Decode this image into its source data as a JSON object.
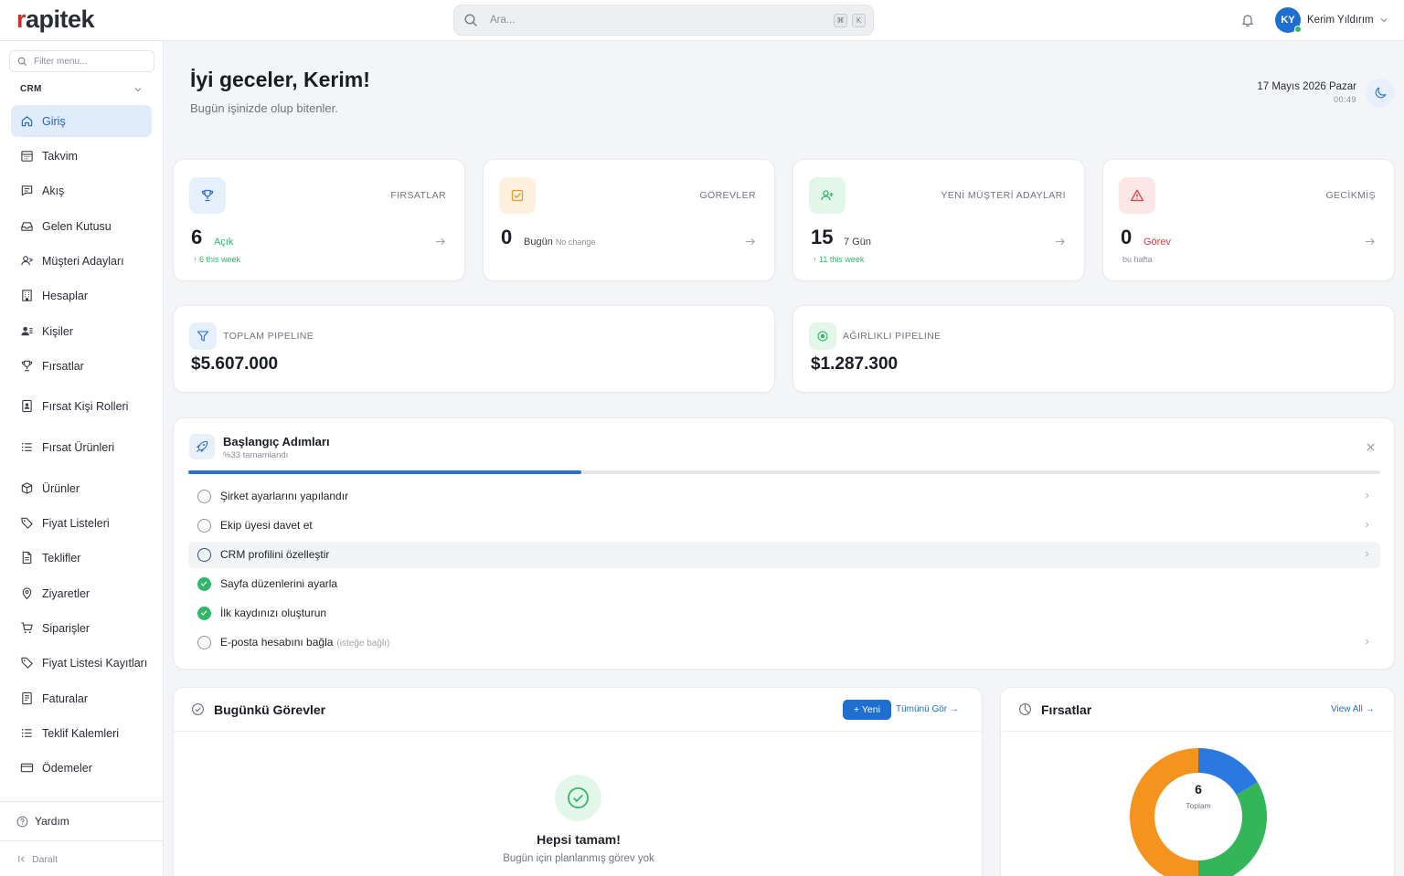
{
  "app": {
    "logo_accent": "r",
    "logo_rest": "apitek",
    "search_placeholder": "Ara...",
    "kbd1": "⌘",
    "kbd2": "K",
    "user_initials": "KY",
    "user_name": "Kerim Yıldırım"
  },
  "sidebar": {
    "filter_placeholder": "Filter menu...",
    "section": "CRM",
    "items": [
      {
        "label": "Giriş",
        "icon": "home-icon",
        "active": true
      },
      {
        "label": "Takvim",
        "icon": "calendar-icon"
      },
      {
        "label": "Akış",
        "icon": "feed-icon"
      },
      {
        "label": "Gelen Kutusu",
        "icon": "inbox-icon"
      },
      {
        "label": "Müşteri Adayları",
        "icon": "leads-icon"
      },
      {
        "label": "Hesaplar",
        "icon": "building-icon"
      },
      {
        "label": "Kişiler",
        "icon": "contacts-icon"
      },
      {
        "label": "Fırsatlar",
        "icon": "trophy-icon"
      },
      {
        "label": "Fırsat Kişi Rolleri",
        "icon": "badge-icon"
      },
      {
        "label": "Fırsat Ürünleri",
        "icon": "list-icon"
      },
      {
        "label": "Ürünler",
        "icon": "box-icon"
      },
      {
        "label": "Fiyat Listeleri",
        "icon": "tag-icon"
      },
      {
        "label": "Teklifler",
        "icon": "document-icon"
      },
      {
        "label": "Ziyaretler",
        "icon": "pin-icon"
      },
      {
        "label": "Siparişler",
        "icon": "cart-icon"
      },
      {
        "label": "Fiyat Listesi Kayıtları",
        "icon": "tag-icon"
      },
      {
        "label": "Faturalar",
        "icon": "invoice-icon"
      },
      {
        "label": "Teklif Kalemleri",
        "icon": "list-icon"
      },
      {
        "label": "Ödemeler",
        "icon": "card-icon"
      }
    ],
    "help": "Yardım",
    "collapse": "Daralt"
  },
  "header": {
    "greeting": "İyi geceler, Kerim!",
    "subtitle": "Bugün işinizde olup bitenler.",
    "date": "17 Mayıs 2026 Pazar",
    "time": "00:49"
  },
  "stats": [
    {
      "label": "FIRSATLAR",
      "value": "6",
      "unit": "Açık",
      "unit_note": "",
      "foot": "↑ 6 this week",
      "icon": "trophy-icon",
      "color": "#2a6fd6"
    },
    {
      "label": "GÖREVLER",
      "value": "0",
      "unit": "Bugün",
      "unit_note": "No change",
      "foot": "",
      "icon": "task-check-icon",
      "color": "#e89a2c"
    },
    {
      "label": "YENİ MÜŞTERİ ADAYLARI",
      "value": "15",
      "unit": "7 Gün",
      "unit_note": "",
      "foot": "↑ 11 this week",
      "icon": "user-plus-icon",
      "color": "#2fb86a"
    },
    {
      "label": "GECİKMİŞ",
      "value": "0",
      "unit": "Görev",
      "unit_note": "",
      "foot": "bu hafta",
      "icon": "warning-icon",
      "color": "#d84444"
    }
  ],
  "pipeline": {
    "total_label": "TOPLAM PIPELINE",
    "total_value": "$5.607.000",
    "weighted_label": "AĞIRLIKLI PIPELINE",
    "weighted_value": "$1.287.300"
  },
  "onboarding": {
    "title": "Başlangıç Adımları",
    "progress_text": "%33 tamamlandı",
    "progress": 0.33,
    "steps": [
      {
        "label": "Şirket ayarlarını yapılandır",
        "note": "",
        "done": false
      },
      {
        "label": "Ekip üyesi davet et",
        "note": "",
        "done": false
      },
      {
        "label": "CRM profilini özelleştir",
        "note": "",
        "done": false,
        "highlight": true
      },
      {
        "label": "Sayfa düzenlerini ayarla",
        "note": "",
        "done": true
      },
      {
        "label": "İlk kaydınızı oluşturun",
        "note": "",
        "done": true
      },
      {
        "label": "E-posta hesabını bağla",
        "note": "(isteğe bağlı)",
        "done": false
      }
    ]
  },
  "tasks": {
    "title": "Bugünkü Görevler",
    "new_button": "+ Yeni",
    "see_all": "Tümünü Gör",
    "empty_title": "Hepsi tamam!",
    "empty_sub": "Bugün için planlanmış görev yok"
  },
  "opportunities": {
    "title": "Fırsatlar",
    "view_all": "View All",
    "total_value": "6",
    "total_label": "Toplam"
  },
  "chart_data": {
    "type": "pie",
    "title": "",
    "center_value": 6,
    "center_label": "Toplam",
    "slices": [
      {
        "value": 1,
        "color": "#2a79e0"
      },
      {
        "value": 2,
        "color": "#35b55a"
      },
      {
        "value": 3,
        "color": "#f5931f"
      }
    ]
  }
}
